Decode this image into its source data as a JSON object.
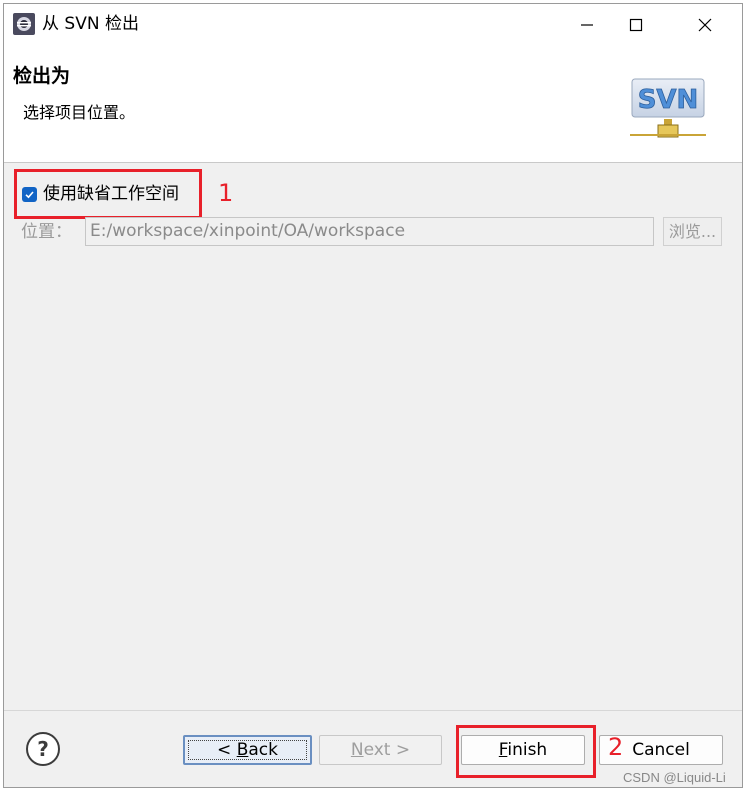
{
  "window": {
    "title": "从 SVN 检出"
  },
  "banner": {
    "title": "检出为",
    "description": "选择项目位置。",
    "logo_text": "SVN"
  },
  "options": {
    "use_default_workspace_label": "使用缺省工作空间",
    "use_default_workspace_checked": true
  },
  "location": {
    "label": "位置：",
    "value": "E:/workspace/xinpoint/OA/workspace",
    "browse_label": "浏览..."
  },
  "buttons": {
    "back_prefix": "< ",
    "back_mnemonic": "B",
    "back_rest": "ack",
    "next_mnemonic": "N",
    "next_rest": "ext >",
    "finish_mnemonic": "F",
    "finish_rest": "inish",
    "cancel": "Cancel"
  },
  "annotations": {
    "step1": "1",
    "step2": "2"
  },
  "watermark": "CSDN @Liquid-Li",
  "colors": {
    "highlight": "#e8202a",
    "checkbox": "#1164c5",
    "svn_logo_fill": "#4f8fd8"
  }
}
